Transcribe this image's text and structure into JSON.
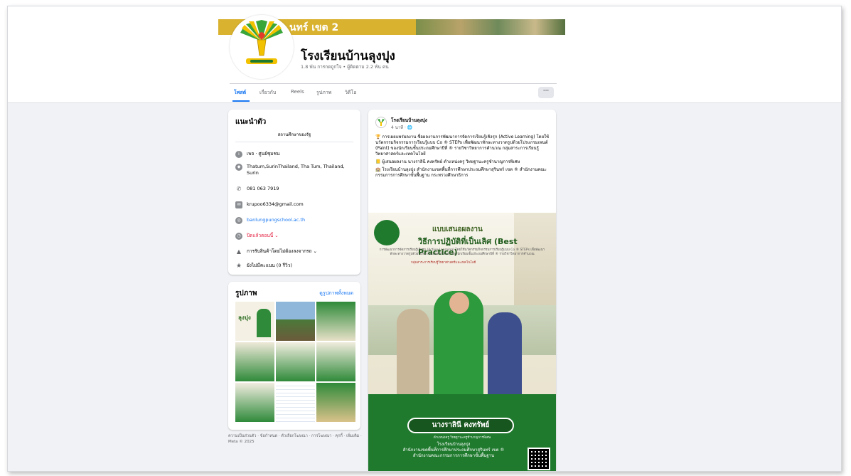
{
  "cover": {
    "text": "นทร์ เขต 2"
  },
  "page": {
    "name": "โรงเรียนบ้านลุงปุง",
    "stats": "1.8 พัน การกดถูกใจ • ผู้ติดตาม 2.2 พัน คน"
  },
  "tabs": [
    {
      "label": "โพสต์",
      "active": true
    },
    {
      "label": "เกี่ยวกับ"
    },
    {
      "label": "Reels"
    },
    {
      "label": "รูปภาพ"
    },
    {
      "label": "วิดีโอ"
    }
  ],
  "more_label": "···",
  "intro": {
    "title": "แนะนำตัว",
    "subtitle": "สถานศึกษาของรัฐ",
    "rows": [
      {
        "icon": "info-icon",
        "text": "เพจ · ศูนย์ชุมชน"
      },
      {
        "icon": "location-icon",
        "text": "Thatum,SurinThailand, Tha Tum, Thailand, Surin"
      },
      {
        "icon": "phone-icon",
        "text": "081 063 7919"
      },
      {
        "icon": "email-icon",
        "text": "krupoo6334@gmail.com"
      },
      {
        "icon": "globe-icon",
        "text": "banlungpungschool.ac.th"
      },
      {
        "icon": "clock-icon",
        "text": "ปิดแล้วตอนนี้ ⌄"
      },
      {
        "icon": "delivery-icon",
        "text": "การรับสินค้าโดยไม่ต้องลงจากรถ ⌄"
      },
      {
        "icon": "star-icon",
        "text": "ยังไม่มีคะแนน (0 รีวิว)"
      }
    ]
  },
  "photos": {
    "title": "รูปภาพ",
    "see_all": "ดูรูปภาพทั้งหมด",
    "first_thumb_text": "ลุงปุง"
  },
  "footer": "ความเป็นส่วนตัว · ข้อกำหนด · ตัวเลือกโฆษณา · การโฆษณา · คุกกี้ · เพิ่มเติม · Meta © 2025",
  "post": {
    "author": "โรงเรียนบ้านลุงปุง",
    "time": "4 นาที · 🌐",
    "lines": [
      "🏆 การเผยแพร่ผลงาน ชื่อผลงานการพัฒนาการจัดการเรียนรู้เชิงรุก (Active Learning) โดยใช้นวัตกรรมกิจกรรมการเรียนรู้แบบ Co ® STEPs เพื่อพัฒนาทักษะทางวาดรูปด้วยโปรแกรมเพนต์ (Paint) ของนักเรียนชั้นประถมศึกษาปีที่ ® รายวิชาวิทยาการคำนวณ กลุ่มสาระการเรียนรู้วิทยาศาสตร์และเทคโนโลยี",
      "📒 ผู้เสนอผลงาน นางราลินี คงทรัพย์ ตำแหน่งครู วิทยฐานะครูชำนาญการพิเศษ",
      "🏫 โรงเรียนบ้านลุงปุง สำนักงานเขตพื้นที่การศึกษาประถมศึกษาสุรินทร์ เขต ® สำนักงานคณะกรรมการการศึกษาขั้นพื้นฐาน กระทรวงศึกษาธิการ"
    ]
  },
  "poster": {
    "heading": "แบบเสนอผลงาน",
    "title": "วิธีการปฏิบัติที่เป็นเลิศ (Best Practice)",
    "description": "การพัฒนาการจัดการเรียนรู้เชิงรุก (Active Learning) โดยใช้นวัตกรรมกิจกรรมการเรียนรู้แบบ Co ® STEPs เพื่อพัฒนาทักษะทางวาดรูปด้วยโปรแกรมเพนต์ (Paint) ของนักเรียนชั้นประถมศึกษาปีที่ ® รายวิชาวิทยาการคำนวณ",
    "group": "กลุ่มสาระการเรียนรู้วิทยาศาสตร์และเทคโนโลยี",
    "name": "นางราลินี คงทรัพย์",
    "role": "ตำแหน่งครู วิทยฐานะครูชำนาญการพิเศษ",
    "footer_lines": [
      "โรงเรียนบ้านลุงปุง",
      "สำนักงานเขตพื้นที่การศึกษาประถมศึกษาสุรินทร์ เขต ®",
      "สำนักงานคณะกรรมการการศึกษาขั้นพื้นฐาน"
    ]
  },
  "colors": {
    "accent": "#1877f2",
    "school_green": "#1f7a2e",
    "school_yellow": "#d9b230"
  }
}
